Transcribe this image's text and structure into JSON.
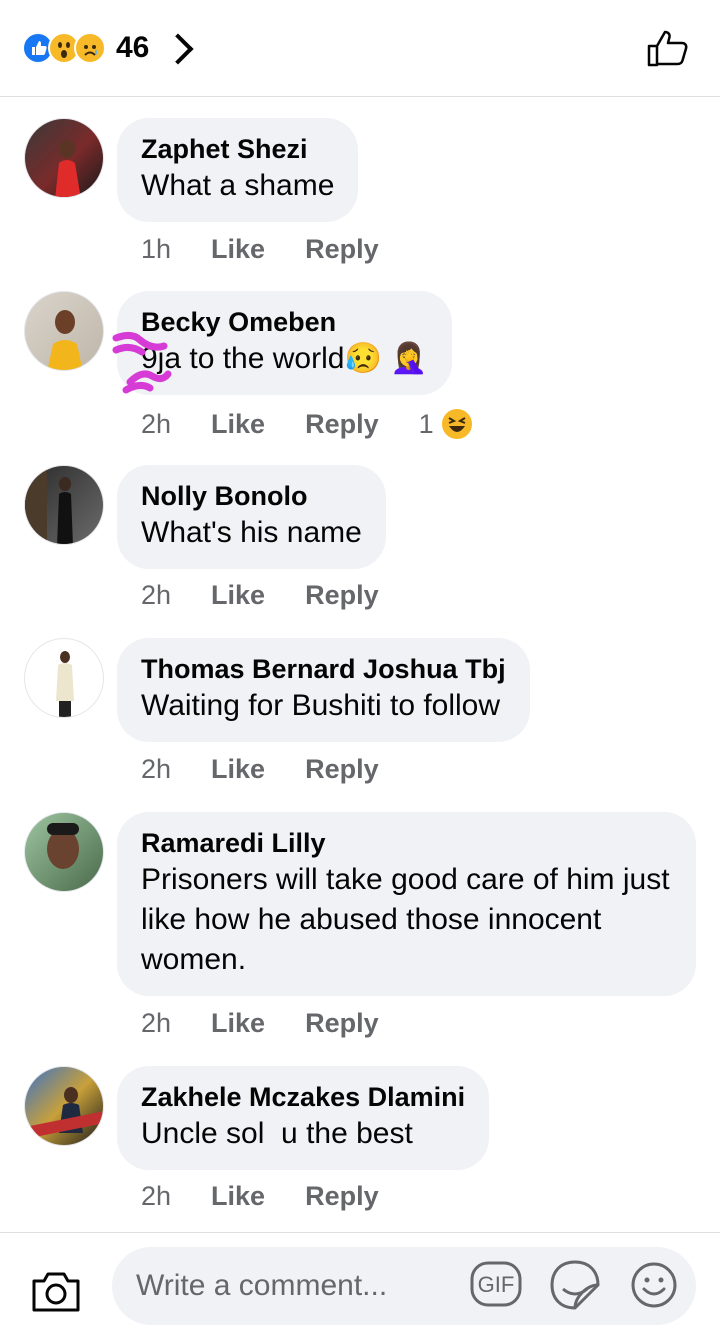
{
  "header": {
    "reaction_count": "46",
    "reaction_icons": [
      "like-icon",
      "wow-icon",
      "sad-icon"
    ]
  },
  "comments": [
    {
      "name": "Zaphet Shezi",
      "text": "What a shame",
      "time": "1h",
      "like_label": "Like",
      "reply_label": "Reply"
    },
    {
      "name": "Becky Omeben",
      "text": "9ja to the world😥 🤦‍♀️",
      "time": "2h",
      "like_label": "Like",
      "reply_label": "Reply",
      "reactions": "1",
      "reaction_icon": "laughing-icon"
    },
    {
      "name": "Nolly Bonolo",
      "text": "What's his name",
      "time": "2h",
      "like_label": "Like",
      "reply_label": "Reply"
    },
    {
      "name": "Thomas Bernard Joshua Tbj",
      "text": "Waiting for Bushiti to follow",
      "time": "2h",
      "like_label": "Like",
      "reply_label": "Reply"
    },
    {
      "name": "Ramaredi Lilly",
      "text": "Prisoners will take good care of him just like how he abused those innocent women.",
      "time": "2h",
      "like_label": "Like",
      "reply_label": "Reply"
    },
    {
      "name": "Zakhele Mczakes Dlamini",
      "text": "Uncle sol  u the best",
      "time": "2h",
      "like_label": "Like",
      "reply_label": "Reply"
    }
  ],
  "footer": {
    "placeholder": "Write a comment...",
    "gif_label": "GIF"
  },
  "colors": {
    "accent": "#1877f2",
    "bubble": "#f0f2f5",
    "secondary_text": "#65676b",
    "emoji_yellow": "#f7b928"
  }
}
